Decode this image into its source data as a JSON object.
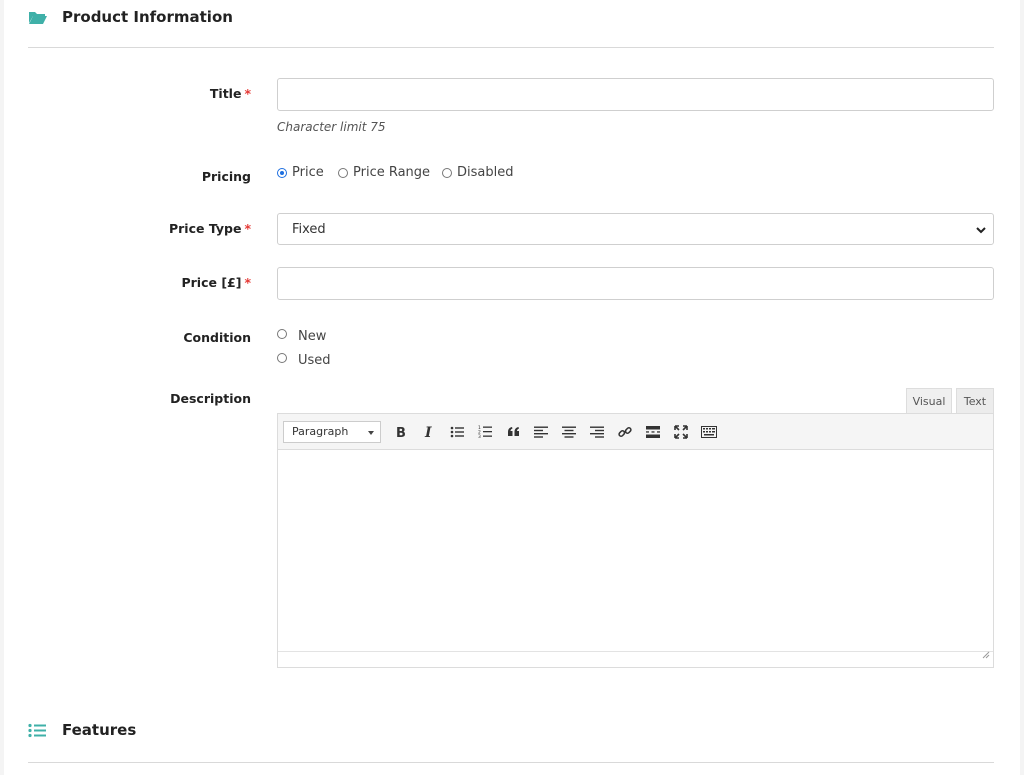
{
  "sections": {
    "product": {
      "title": "Product Information",
      "icon": "folder-open-icon"
    },
    "features": {
      "title": "Features",
      "icon": "list-icon"
    }
  },
  "colors": {
    "accent": "#3fb0a8",
    "required": "#e53935",
    "radio_checked": "#1e6fe0"
  },
  "form": {
    "title": {
      "label": "Title",
      "required": "*",
      "value": "",
      "hint": "Character limit 75"
    },
    "pricing": {
      "label": "Pricing",
      "options": [
        "Price",
        "Price Range",
        "Disabled"
      ],
      "selected": "Price"
    },
    "price_type": {
      "label": "Price Type",
      "required": "*",
      "value": "Fixed"
    },
    "price": {
      "label": "Price [£]",
      "required": "*",
      "value": ""
    },
    "condition": {
      "label": "Condition",
      "options": [
        "New",
        "Used"
      ],
      "selected": ""
    },
    "description": {
      "label": "Description",
      "tabs": [
        "Visual",
        "Text"
      ],
      "active_tab": "Visual",
      "format_select": "Paragraph",
      "toolbar_icons": [
        "bold-icon",
        "italic-icon",
        "bullet-list-icon",
        "numbered-list-icon",
        "blockquote-icon",
        "align-left-icon",
        "align-center-icon",
        "align-right-icon",
        "link-icon",
        "read-more-icon",
        "fullscreen-icon",
        "toolbar-toggle-icon"
      ],
      "value": ""
    }
  }
}
